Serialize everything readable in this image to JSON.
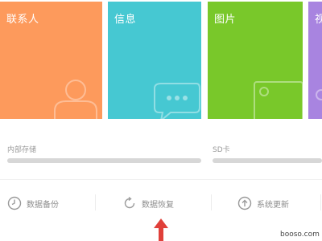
{
  "tiles": {
    "contacts": {
      "label": "联系人",
      "color": "#fd9a5c",
      "icon": "person-icon"
    },
    "messages": {
      "label": "信息",
      "color": "#46c8d2",
      "icon": "chat-bubble-icon"
    },
    "photos": {
      "label": "图片",
      "color": "#79c82a",
      "icon": "image-icon"
    },
    "videos": {
      "label": "视",
      "color": "#a884e0",
      "icon": "video-icon"
    }
  },
  "storage": {
    "internal": {
      "label": "内部存储",
      "usage_fraction": 1.0
    },
    "sd_card": {
      "label": "SD卡",
      "usage_fraction": 1.0
    }
  },
  "actions": {
    "backup": {
      "label": "数据备份",
      "icon": "clock-icon"
    },
    "restore": {
      "label": "数据恢复",
      "icon": "refresh-icon"
    },
    "update": {
      "label": "系统更新",
      "icon": "upload-arrow-icon"
    }
  },
  "annotation": {
    "icon": "red-arrow-up-icon",
    "color": "#e0403a"
  },
  "watermark": "booso.com",
  "colors": {
    "divider": "#f0f0f0",
    "muted_text": "#8c8c8c"
  }
}
